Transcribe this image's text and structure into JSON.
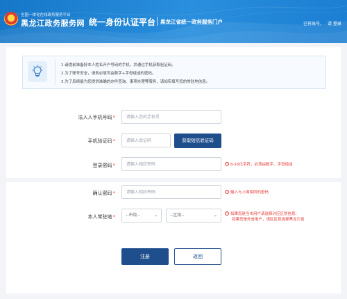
{
  "header": {
    "org_subtitle": "全国一体化在线政务服务平台",
    "org_name": "黑龙江政务服务网",
    "title": "统一身份认证平台",
    "subtitle": "黑龙江省统一政务服务门户",
    "account_text": "已有账号,",
    "login_link": "请 登录"
  },
  "notice": {
    "lines": [
      "1.请提前准备好本人姓名开户号码的手机，并通过手机获取验证码。",
      "2.为了账号安全，请务必填写由数字+字母组成的密码。",
      "3.为了后续能为您提供准确的办件查询、事项办理等服务，请如实填写您的常驻地信息。"
    ]
  },
  "form": {
    "phone": {
      "label": "法人人手机号码",
      "placeholder": "请输入您的手机号"
    },
    "sms": {
      "label": "手机验证码",
      "placeholder": "请输入验证码",
      "button": "获取短信验证码"
    },
    "password": {
      "label": "登录密码",
      "placeholder": "请输入相应密码",
      "hint": "8-16位字符，必须由数字、字母组成"
    },
    "confirm": {
      "label": "确认密码",
      "placeholder": "请输入相应密码",
      "hint": "输入与上面相同的密码"
    },
    "residence": {
      "label": "本人常驻地",
      "city_default": "--市级--",
      "district_default": "--区级--",
      "hint_line1": "如果您是当市用户请选择对应区划信息;",
      "hint_line2": "如果您是外省用户，请区区划选择黑龙江省"
    },
    "required_mark": "*",
    "hint_mark": "!",
    "caret": "⌄"
  },
  "actions": {
    "register": "注册",
    "back": "返回"
  },
  "colors": {
    "header": "#1677c8",
    "primary_button": "#1f4e8c",
    "error": "#e53935"
  }
}
